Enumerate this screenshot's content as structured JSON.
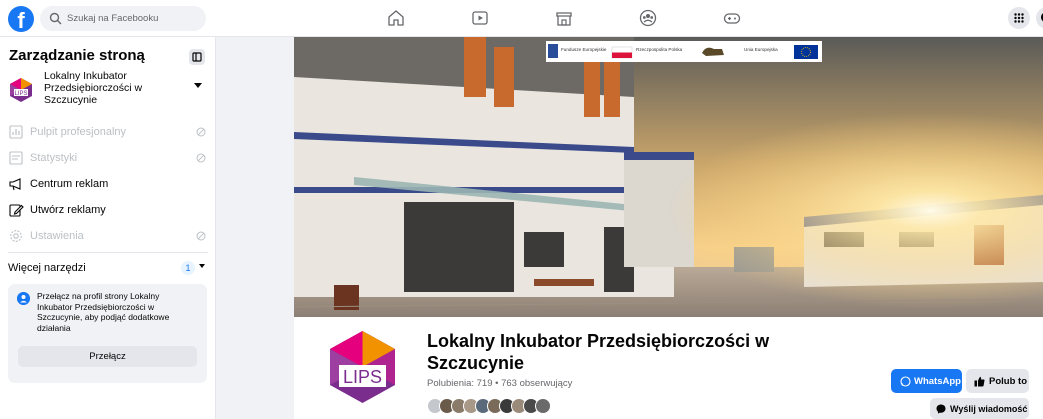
{
  "topbar": {
    "logo": "f",
    "search_placeholder": "Szukaj na Facebooku",
    "nav_icons": [
      "home-icon",
      "watch-icon",
      "marketplace-icon",
      "groups-icon",
      "gaming-icon"
    ],
    "right_icons": [
      "menu-grid-icon",
      "messenger-icon"
    ]
  },
  "sidebar": {
    "title": "Zarządzanie stroną",
    "page_name": "Lokalny Inkubator Przedsiębiorczości w Szczucynie",
    "items": [
      {
        "label": "Pulpit profesjonalny",
        "icon": "dashboard-icon",
        "disabled": true
      },
      {
        "label": "Statystyki",
        "icon": "insights-icon",
        "disabled": true
      },
      {
        "label": "Centrum reklam",
        "icon": "megaphone-icon",
        "disabled": false
      },
      {
        "label": "Utwórz reklamy",
        "icon": "edit-icon",
        "disabled": false
      },
      {
        "label": "Ustawienia",
        "icon": "gear-icon",
        "disabled": true
      }
    ],
    "more_tools": {
      "label": "Więcej narzędzi",
      "badge": "1"
    },
    "switch_card": {
      "text": "Przełącz na profil strony Lokalny Inkubator Przedsiębiorczości w Szczucynie, aby podjąć dodatkowe działania",
      "button": "Przełącz"
    }
  },
  "cover": {
    "banner_labels": [
      "Fundusze Europejskie",
      "Rzeczpospolita Polska",
      "Unia Europejska"
    ]
  },
  "profile": {
    "logo_text": "LIPS",
    "title_line1": "Lokalny Inkubator Przedsiębiorczości w",
    "title_line2": "Szczucynie",
    "stats": "Polubienia: 719 • 763 obserwujący",
    "buttons": {
      "whatsapp": "WhatsApp",
      "like": "Polub to",
      "message": "Wyślij wiadomość"
    }
  },
  "colors": {
    "accent": "#1877f2",
    "logo_purple": "#7b2d8e",
    "logo_orange": "#f39200"
  }
}
